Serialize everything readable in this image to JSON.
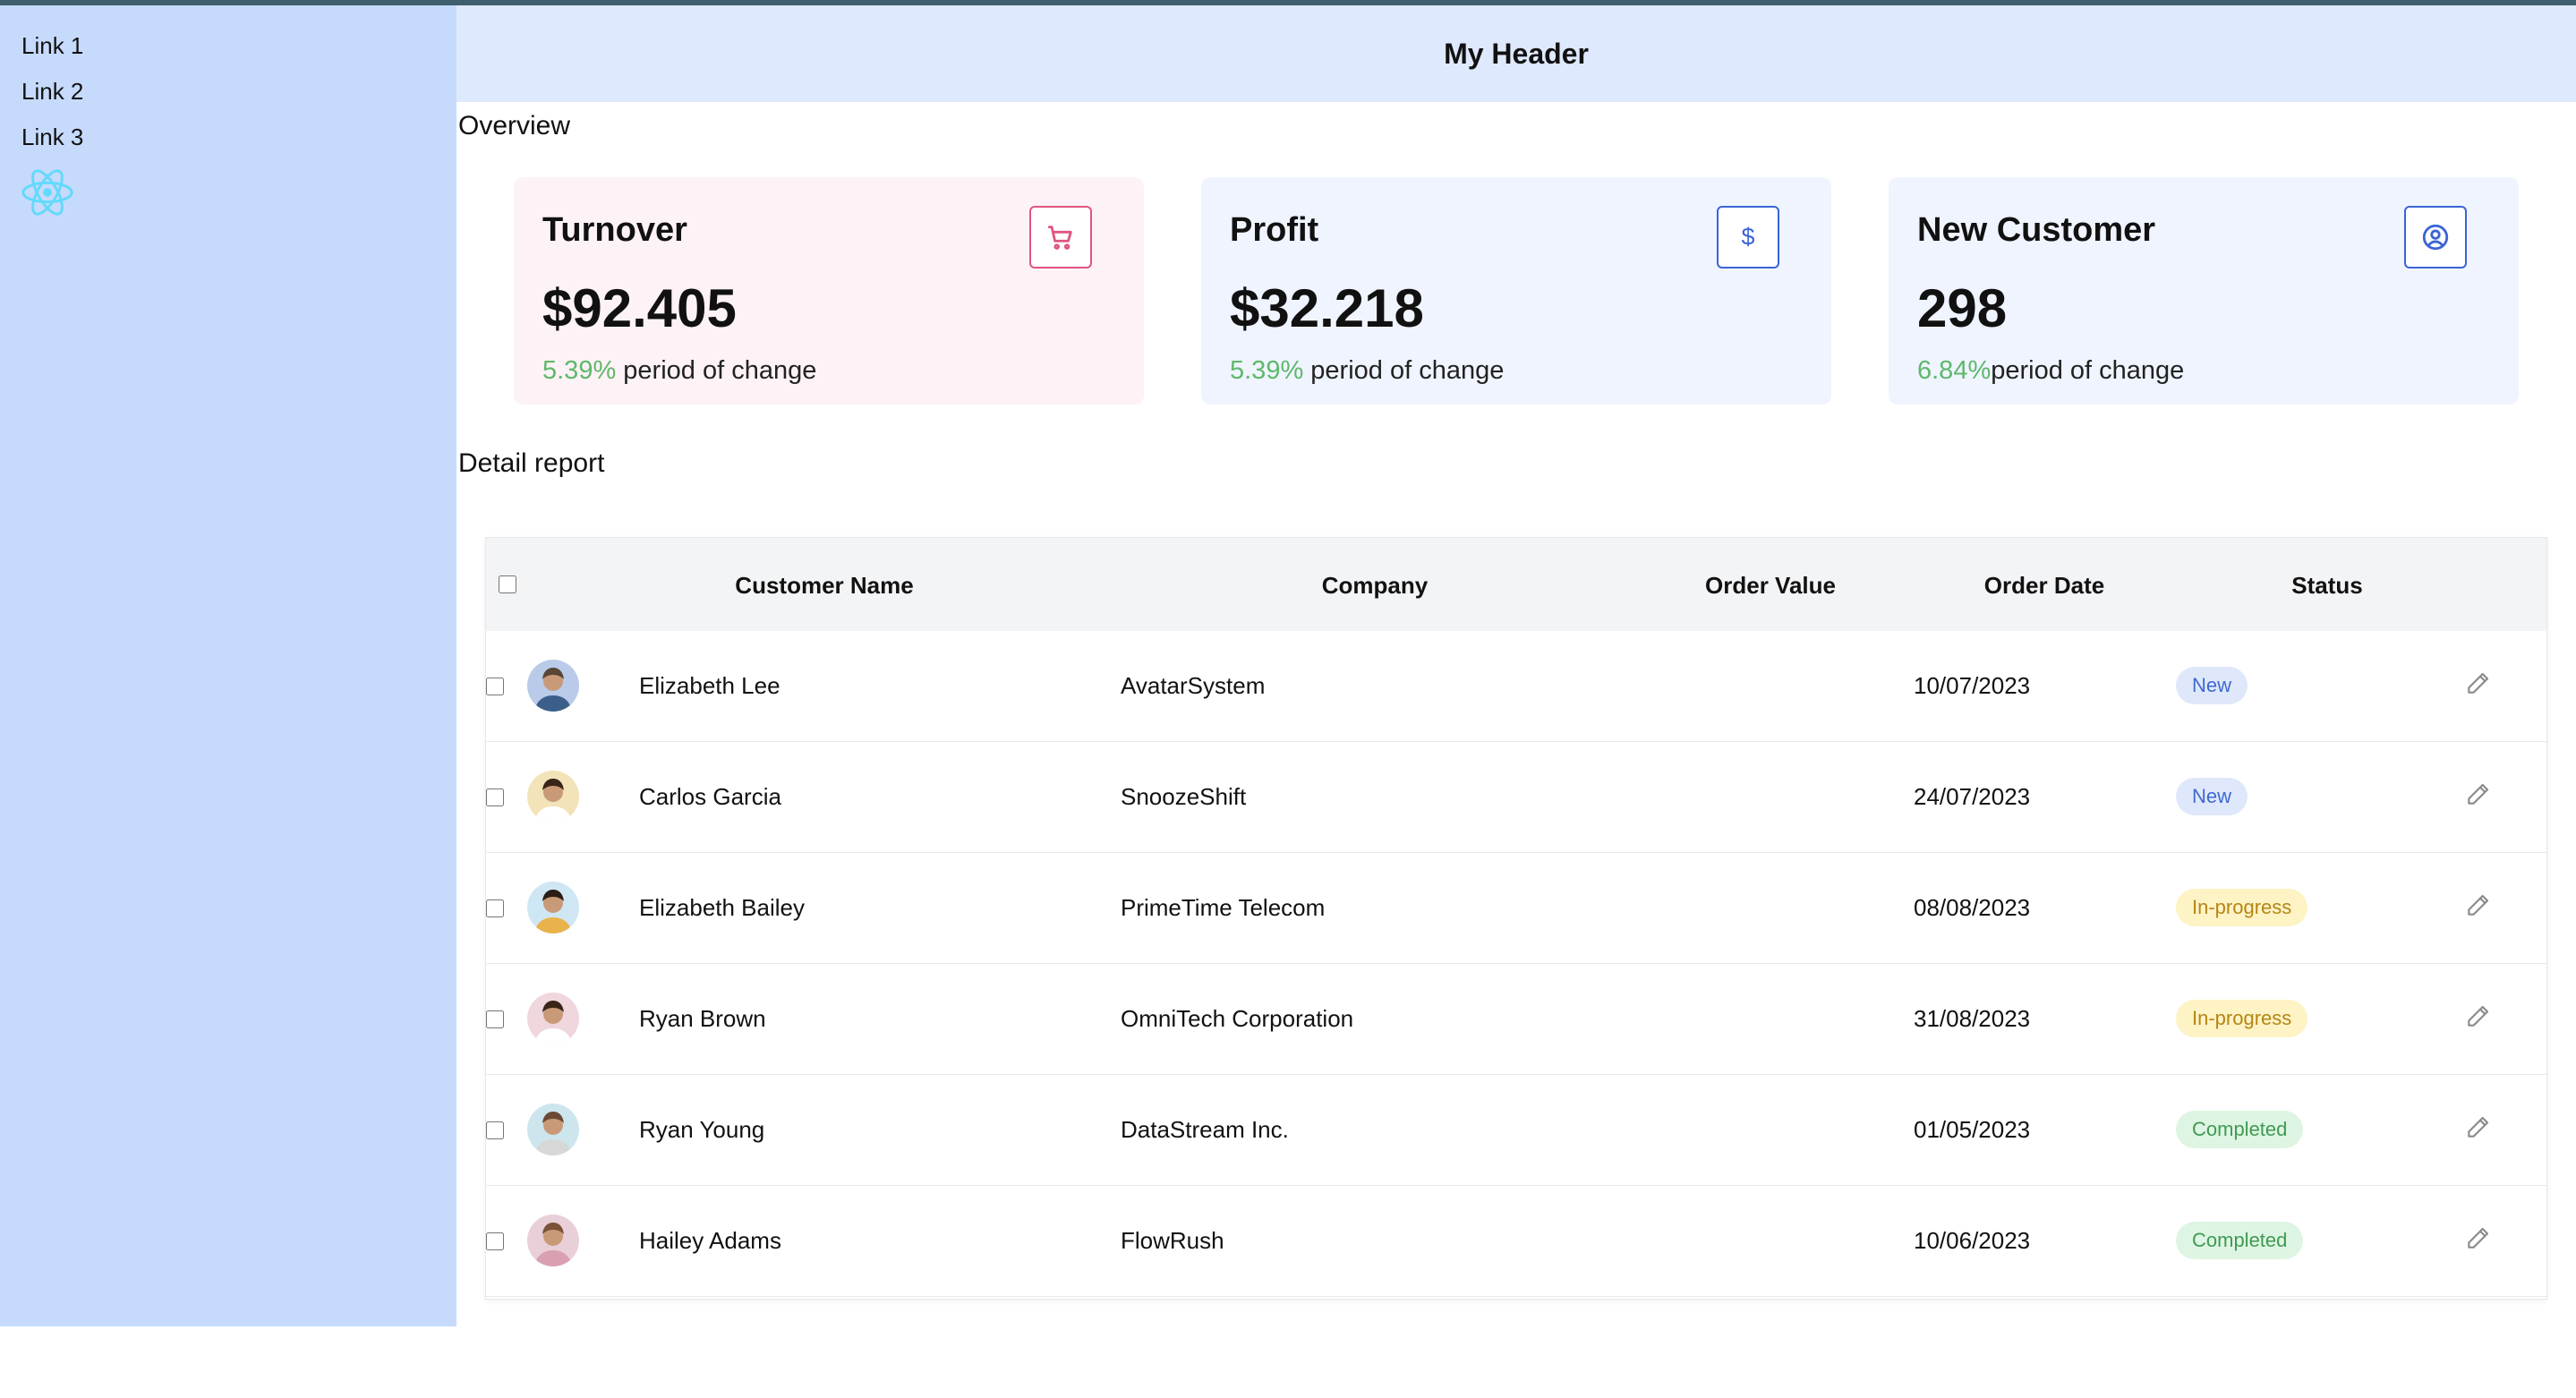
{
  "sidebar": {
    "links": [
      "Link 1",
      "Link 2",
      "Link 3"
    ],
    "logo_icon": "react-logo-icon"
  },
  "header": {
    "title": "My Header"
  },
  "overview": {
    "title": "Overview",
    "cards": [
      {
        "title": "Turnover",
        "value": "$92.405",
        "change_pct": "5.39%",
        "change_label": " period of change",
        "icon": "shopping-cart-icon",
        "bg": "#fdf2f6",
        "accent": "#e0557e"
      },
      {
        "title": "Profit",
        "value": "$32.218",
        "change_pct": "5.39%",
        "change_label": " period of change",
        "icon": "dollar-icon",
        "bg": "#eff4fe",
        "accent": "#3a64d6"
      },
      {
        "title": "New Customer",
        "value": "298",
        "change_pct": "6.84%",
        "change_label": "period of change",
        "icon": "user-circle-icon",
        "bg": "#eff4fe",
        "accent": "#3a64d6"
      }
    ]
  },
  "report": {
    "title": "Detail report",
    "columns": [
      "Customer Name",
      "Company",
      "Order Value",
      "Order Date",
      "Status"
    ],
    "rows": [
      {
        "name": "Elizabeth Lee",
        "company": "AvatarSystem",
        "order_value": "",
        "date": "10/07/2023",
        "status": "New"
      },
      {
        "name": "Carlos Garcia",
        "company": "SnoozeShift",
        "order_value": "",
        "date": "24/07/2023",
        "status": "New"
      },
      {
        "name": "Elizabeth Bailey",
        "company": "PrimeTime Telecom",
        "order_value": "",
        "date": "08/08/2023",
        "status": "In-progress"
      },
      {
        "name": "Ryan Brown",
        "company": "OmniTech Corporation",
        "order_value": "",
        "date": "31/08/2023",
        "status": "In-progress"
      },
      {
        "name": "Ryan Young",
        "company": "DataStream Inc.",
        "order_value": "",
        "date": "01/05/2023",
        "status": "Completed"
      },
      {
        "name": "Hailey Adams",
        "company": "FlowRush",
        "order_value": "",
        "date": "10/06/2023",
        "status": "Completed"
      }
    ],
    "status_colors": {
      "New": {
        "bg": "#dfe8fb",
        "fg": "#3e6ad0"
      },
      "In-progress": {
        "bg": "#fdf3c4",
        "fg": "#b58616"
      },
      "Completed": {
        "bg": "#dff5e3",
        "fg": "#3f9a52"
      }
    },
    "row_icons": {
      "avatar": "user-avatar-icon",
      "edit": "pencil-edit-icon"
    }
  }
}
